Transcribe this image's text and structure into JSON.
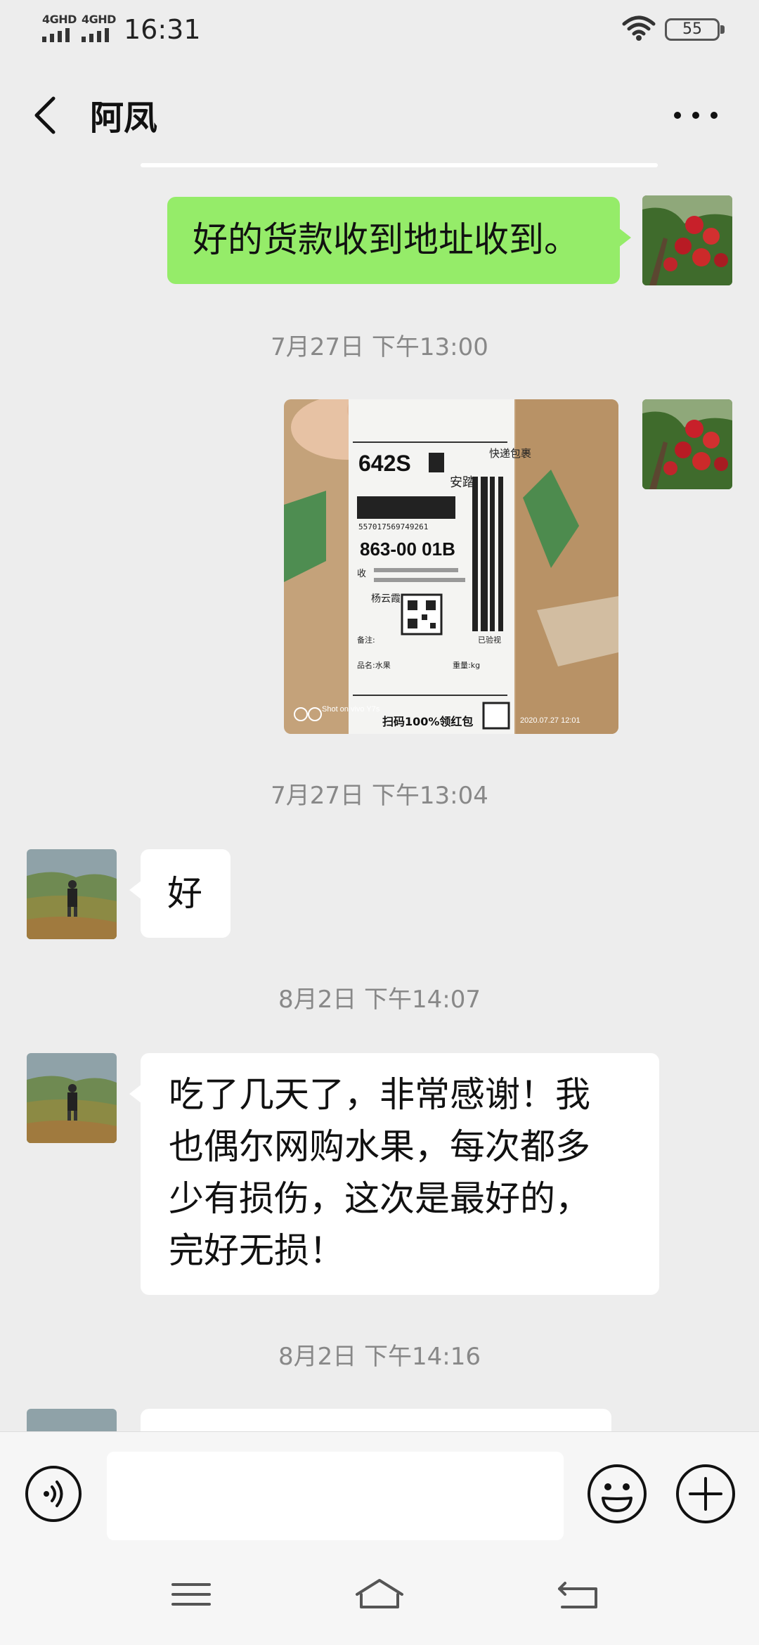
{
  "status_bar": {
    "signal_1": "4GHD",
    "signal_2": "4GHD",
    "time": "16:31",
    "battery": "55",
    "icons": [
      "signal-icon",
      "wifi-icon",
      "battery-icon"
    ]
  },
  "header": {
    "title": "阿凤",
    "icons": [
      "back-chevron-icon",
      "more-dots-icon"
    ]
  },
  "messages": [
    {
      "type": "text",
      "side": "sent",
      "text": "好的货款收到地址收到。"
    },
    {
      "type": "timestamp",
      "text": "7月27日 下午13:00"
    },
    {
      "type": "image",
      "side": "sent"
    },
    {
      "type": "timestamp",
      "text": "7月27日 下午13:04"
    },
    {
      "type": "text",
      "side": "received",
      "text": "好"
    },
    {
      "type": "timestamp",
      "text": "8月2日 下午14:07"
    },
    {
      "type": "text",
      "side": "received",
      "lines": [
        "吃了几天了，非常感谢！我",
        "也偶尔网购水果，每次都多",
        "少有损伤，这次是最好的，",
        "完好无损！"
      ]
    },
    {
      "type": "timestamp",
      "text": "8月2日 下午14:16"
    },
    {
      "type": "text",
      "side": "received",
      "text": ""
    }
  ],
  "shipping_label": {
    "sort_code": "642S",
    "region": "安踏",
    "route_code": "863-00 01B",
    "express_tag": "快递包裹",
    "promo": "扫码100%领红包",
    "waybill_no": "557017569749261",
    "recipient_tag": "收",
    "sender_name": "杨云霞",
    "remark_label": "备注:",
    "goods_label": "品名:水果",
    "weight_label": "重量:kg",
    "signed_label": "已验视"
  },
  "photo_watermark": {
    "camera": "Shot on vivo Y7s",
    "datetime": "2020.07.27 12:01"
  },
  "input_bar": {
    "placeholder": "",
    "icons": [
      "voice-icon",
      "emoji-icon",
      "plus-icon"
    ]
  },
  "nav_bar": {
    "icons": [
      "menu-icon",
      "home-icon",
      "back-icon"
    ]
  },
  "colors": {
    "background": "#ededed",
    "sent_bubble": "#95ec69",
    "received_bubble": "#ffffff",
    "timestamp": "#888888"
  }
}
